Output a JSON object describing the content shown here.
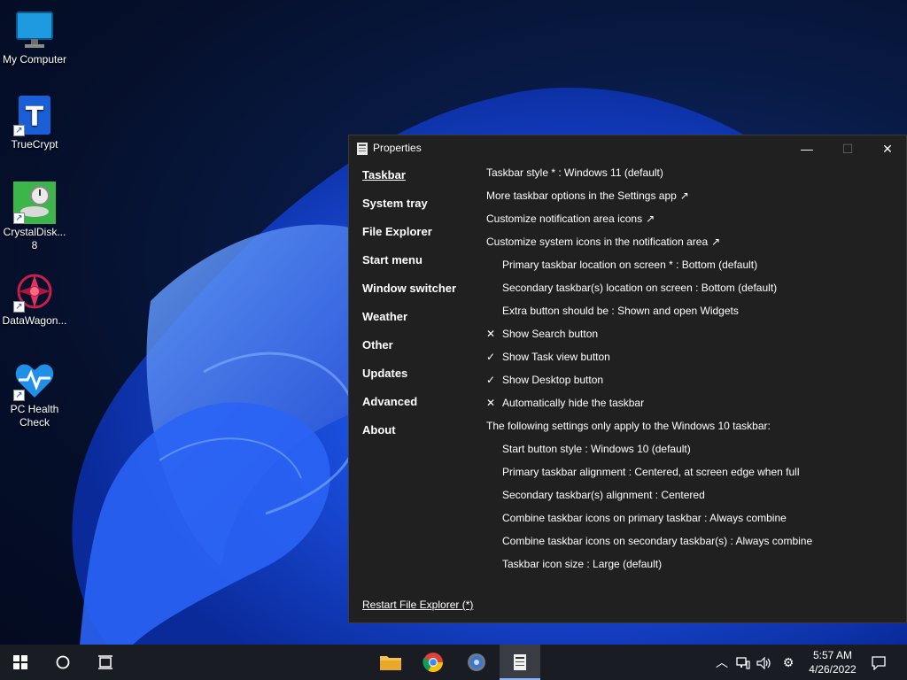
{
  "desktop": {
    "icons": [
      {
        "label": "My Computer"
      },
      {
        "label": "TrueCrypt"
      },
      {
        "label": "CrystalDisk... 8"
      },
      {
        "label": "DataWagon..."
      },
      {
        "label": "PC Health Check"
      }
    ]
  },
  "window": {
    "title": "Properties",
    "controls": {
      "minimize": "—",
      "maximize": "☐",
      "close": "✕"
    },
    "nav": [
      {
        "label": "Taskbar",
        "active": true
      },
      {
        "label": "System tray"
      },
      {
        "label": "File Explorer"
      },
      {
        "label": "Start menu"
      },
      {
        "label": "Window switcher"
      },
      {
        "label": "Weather"
      },
      {
        "label": "Other"
      },
      {
        "label": "Updates"
      },
      {
        "label": "Advanced"
      },
      {
        "label": "About"
      }
    ],
    "settings": [
      {
        "text": "Taskbar style * : Windows 11 (default)",
        "mark": "",
        "ext": ""
      },
      {
        "text": "More taskbar options in the Settings app",
        "mark": "",
        "ext": "↗"
      },
      {
        "text": "Customize notification area icons",
        "mark": "",
        "ext": "↗"
      },
      {
        "text": "Customize system icons in the notification area",
        "mark": "",
        "ext": "↗"
      },
      {
        "text": "Primary taskbar location on screen * : Bottom (default)",
        "mark": "",
        "ext": ""
      },
      {
        "text": "Secondary taskbar(s) location on screen : Bottom (default)",
        "mark": "",
        "ext": ""
      },
      {
        "text": "Extra button should be : Shown and open Widgets",
        "mark": "",
        "ext": ""
      },
      {
        "text": "Show Search button",
        "mark": "✕",
        "ext": ""
      },
      {
        "text": "Show Task view button",
        "mark": "✓",
        "ext": ""
      },
      {
        "text": "Show Desktop button",
        "mark": "✓",
        "ext": ""
      },
      {
        "text": "Automatically hide the taskbar",
        "mark": "✕",
        "ext": ""
      },
      {
        "text": "The following settings only apply to the Windows 10 taskbar:",
        "mark": "",
        "ext": ""
      },
      {
        "text": "Start button style : Windows 10 (default)",
        "mark": "",
        "ext": ""
      },
      {
        "text": "Primary taskbar alignment : Centered, at screen edge when full",
        "mark": "",
        "ext": ""
      },
      {
        "text": "Secondary taskbar(s) alignment : Centered",
        "mark": "",
        "ext": ""
      },
      {
        "text": "Combine taskbar icons on primary taskbar : Always combine",
        "mark": "",
        "ext": ""
      },
      {
        "text": "Combine taskbar icons on secondary taskbar(s) : Always combine",
        "mark": "",
        "ext": ""
      },
      {
        "text": "Taskbar icon size : Large (default)",
        "mark": "",
        "ext": ""
      }
    ],
    "restart_link": "Restart File Explorer (*)"
  },
  "taskbar": {
    "clock": {
      "time": "5:57 AM",
      "date": "4/26/2022"
    },
    "pinned": [
      {
        "name": "file-explorer-icon"
      },
      {
        "name": "chrome-icon"
      },
      {
        "name": "settings-app-icon"
      },
      {
        "name": "properties-app-icon",
        "active": true
      }
    ]
  },
  "colors": {
    "accent": "#1a5cff",
    "window_bg": "#202020",
    "taskbar_bg": "#1a1c24"
  }
}
